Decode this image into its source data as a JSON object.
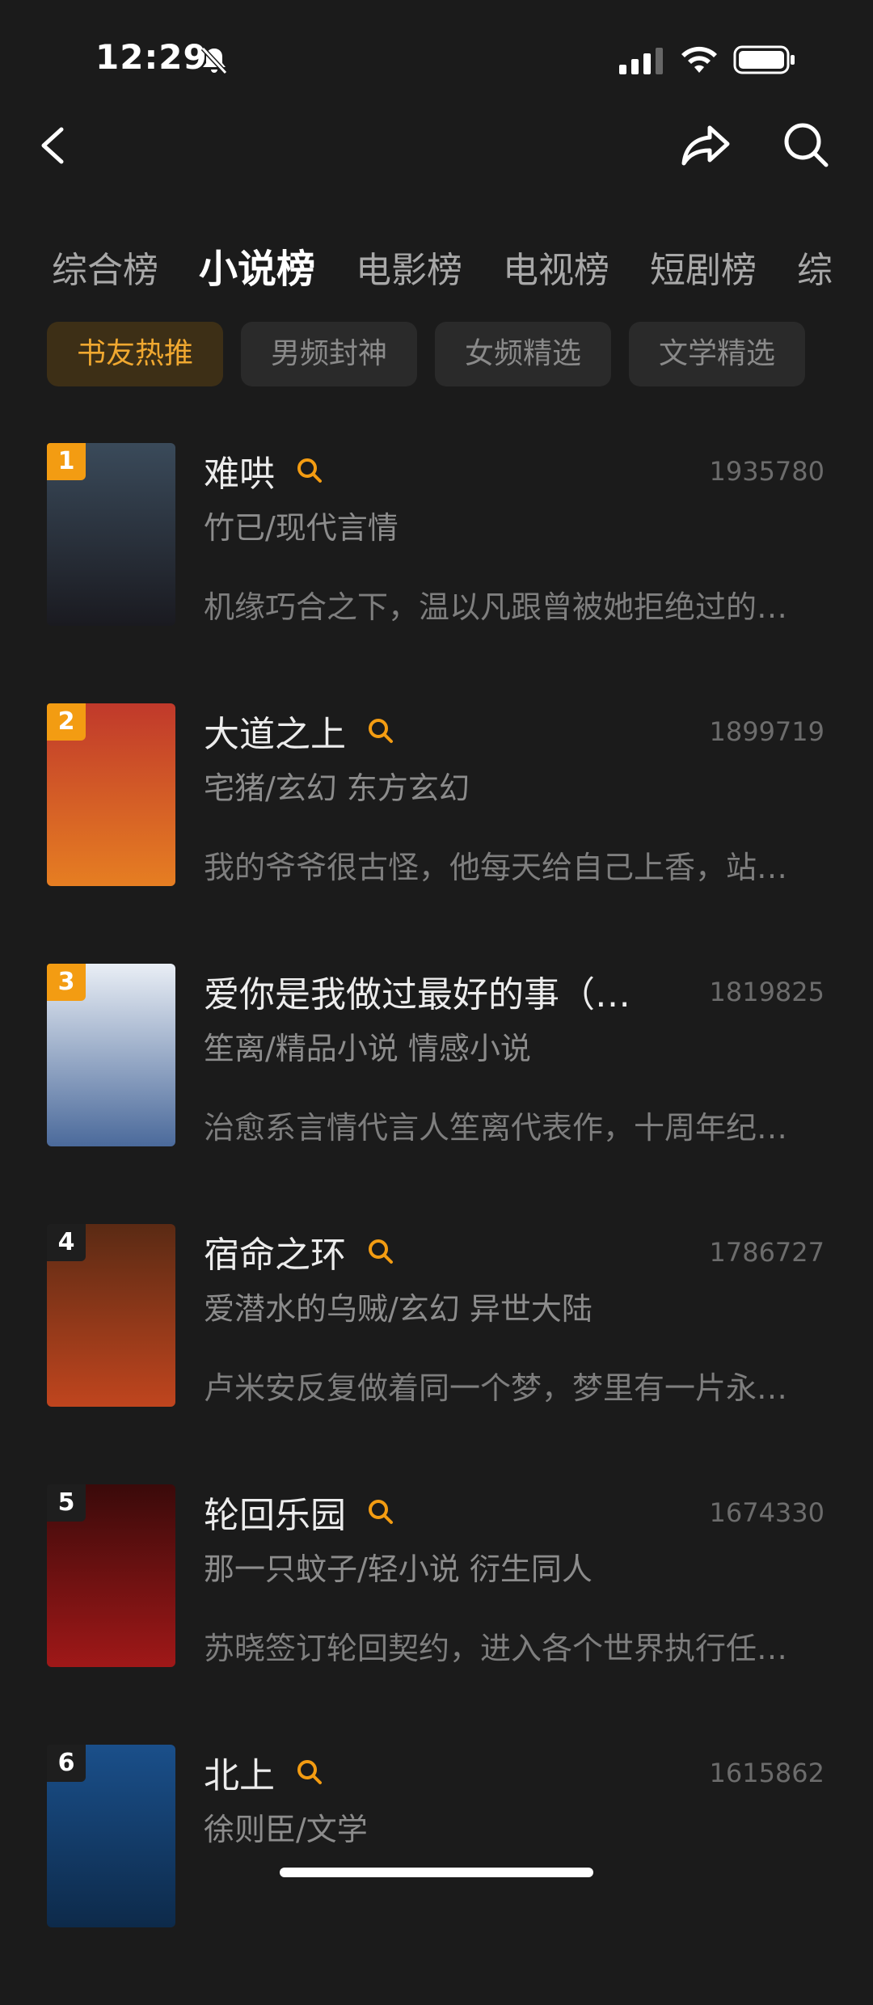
{
  "status": {
    "time": "12:29"
  },
  "categories": [
    {
      "label": "综合榜",
      "active": false
    },
    {
      "label": "小说榜",
      "active": true
    },
    {
      "label": "电影榜",
      "active": false
    },
    {
      "label": "电视榜",
      "active": false
    },
    {
      "label": "短剧榜",
      "active": false
    },
    {
      "label": "综",
      "active": false
    }
  ],
  "subtabs": [
    {
      "label": "书友热推",
      "active": true
    },
    {
      "label": "男频封神",
      "active": false
    },
    {
      "label": "女频精选",
      "active": false
    },
    {
      "label": "文学精选",
      "active": false
    }
  ],
  "books": [
    {
      "rank": "1",
      "title": "难哄",
      "count": "1935780",
      "author": "竹已/现代言情",
      "desc": "机缘巧合之下，温以凡跟曾被她拒绝过的…",
      "search": true,
      "cover_top": "#3a4a5a",
      "cover_bottom": "#1a1a20"
    },
    {
      "rank": "2",
      "title": "大道之上",
      "count": "1899719",
      "author": "宅猪/玄幻 东方玄幻",
      "desc": "我的爷爷很古怪，他每天给自己上香，站…",
      "search": true,
      "cover_top": "#c0392b",
      "cover_bottom": "#e67e22"
    },
    {
      "rank": "3",
      "title": "爱你是我做过最好的事（…",
      "count": "1819825",
      "author": "笙离/精品小说 情感小说",
      "desc": "治愈系言情代言人笙离代表作，十周年纪…",
      "search": false,
      "cover_top": "#e9eef5",
      "cover_bottom": "#4b6a9b"
    },
    {
      "rank": "4",
      "title": "宿命之环",
      "count": "1786727",
      "author": "爱潜水的乌贼/玄幻 异世大陆",
      "desc": "卢米安反复做着同一个梦，梦里有一片永…",
      "search": true,
      "cover_top": "#5a2a14",
      "cover_bottom": "#c0451e"
    },
    {
      "rank": "5",
      "title": "轮回乐园",
      "count": "1674330",
      "author": "那一只蚊子/轻小说 衍生同人",
      "desc": "苏晓签订轮回契约，进入各个世界执行任…",
      "search": true,
      "cover_top": "#3a0a0a",
      "cover_bottom": "#a01818"
    },
    {
      "rank": "6",
      "title": "北上",
      "count": "1615862",
      "author": "徐则臣/文学",
      "desc": "",
      "search": true,
      "cover_top": "#1a4f8a",
      "cover_bottom": "#0d2a4a"
    }
  ]
}
